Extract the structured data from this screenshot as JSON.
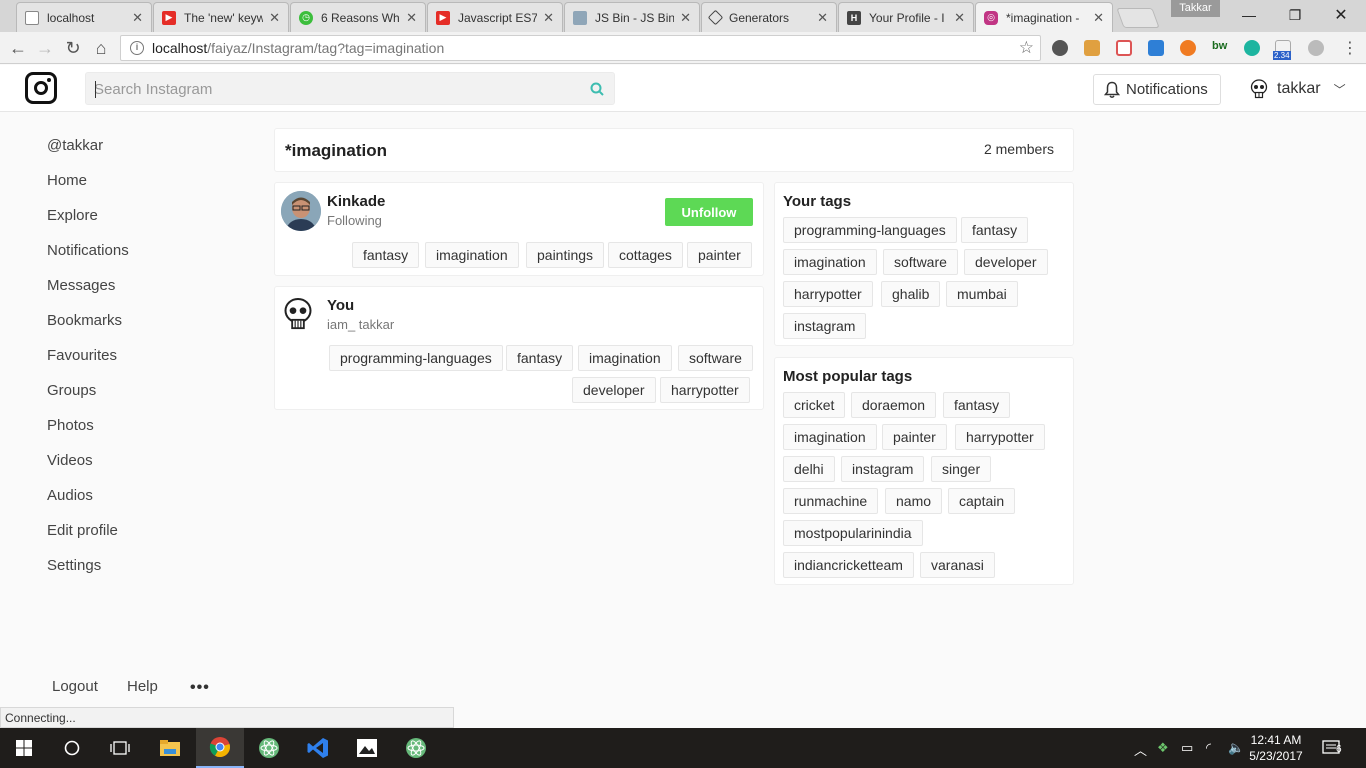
{
  "browser": {
    "tabs": [
      {
        "title": "localhost",
        "favicon": "page-icon",
        "active": false
      },
      {
        "title": "The 'new' keyw",
        "favicon": "youtube-icon",
        "active": false
      },
      {
        "title": "6 Reasons Wh",
        "favicon": "stopwatch-icon",
        "active": false
      },
      {
        "title": "Javascript ES7",
        "favicon": "youtube-icon",
        "active": false
      },
      {
        "title": "JS Bin - JS Bin",
        "favicon": "jsbin-icon",
        "active": false
      },
      {
        "title": "Generators",
        "favicon": "codepen-icon",
        "active": false
      },
      {
        "title": "Your Profile - I",
        "favicon": "hashnode-icon",
        "active": false
      },
      {
        "title": "*imagination -",
        "favicon": "instagram-icon",
        "active": true
      }
    ],
    "profile_name": "Takkar",
    "url_host": "localhost",
    "url_path": "/faiyaz/Instagram/tag?tag=imagination",
    "status_text": "Connecting...",
    "extension_badge": "2.34"
  },
  "header": {
    "search_placeholder": "Search Instagram",
    "notifications_label": "Notifications",
    "username": "takkar"
  },
  "sidebar": {
    "handle": "@takkar",
    "items": [
      "Home",
      "Explore",
      "Notifications",
      "Messages",
      "Bookmarks",
      "Favourites",
      "Groups",
      "Photos",
      "Videos",
      "Audios",
      "Edit profile",
      "Settings"
    ],
    "footer": {
      "logout": "Logout",
      "help": "Help",
      "more": "•••"
    }
  },
  "tag_page": {
    "title": "*imagination",
    "members_count": "2 members",
    "members": [
      {
        "name": "Kinkade",
        "subtitle": "Following",
        "action": "Unfollow",
        "tags": [
          "fantasy",
          "imagination",
          "paintings",
          "cottages",
          "painter"
        ]
      },
      {
        "name": "You",
        "subtitle": "iam_ takkar",
        "tags": [
          "programming-languages",
          "fantasy",
          "imagination",
          "software",
          "developer",
          "harrypotter"
        ]
      }
    ]
  },
  "your_tags": {
    "title": "Your tags",
    "tags": [
      "programming-languages",
      "fantasy",
      "imagination",
      "software",
      "developer",
      "harrypotter",
      "ghalib",
      "mumbai",
      "instagram"
    ]
  },
  "popular_tags": {
    "title": "Most popular tags",
    "tags": [
      "cricket",
      "doraemon",
      "fantasy",
      "imagination",
      "painter",
      "harrypotter",
      "delhi",
      "instagram",
      "singer",
      "runmachine",
      "namo",
      "captain",
      "mostpopularinindia",
      "indiancricketteam",
      "varanasi"
    ]
  },
  "taskbar": {
    "time": "12:41 AM",
    "date": "5/23/2017",
    "notification_count": "6"
  },
  "colors": {
    "unfollow_green": "#5dd955",
    "search_icon_teal": "#3dbdb0"
  }
}
